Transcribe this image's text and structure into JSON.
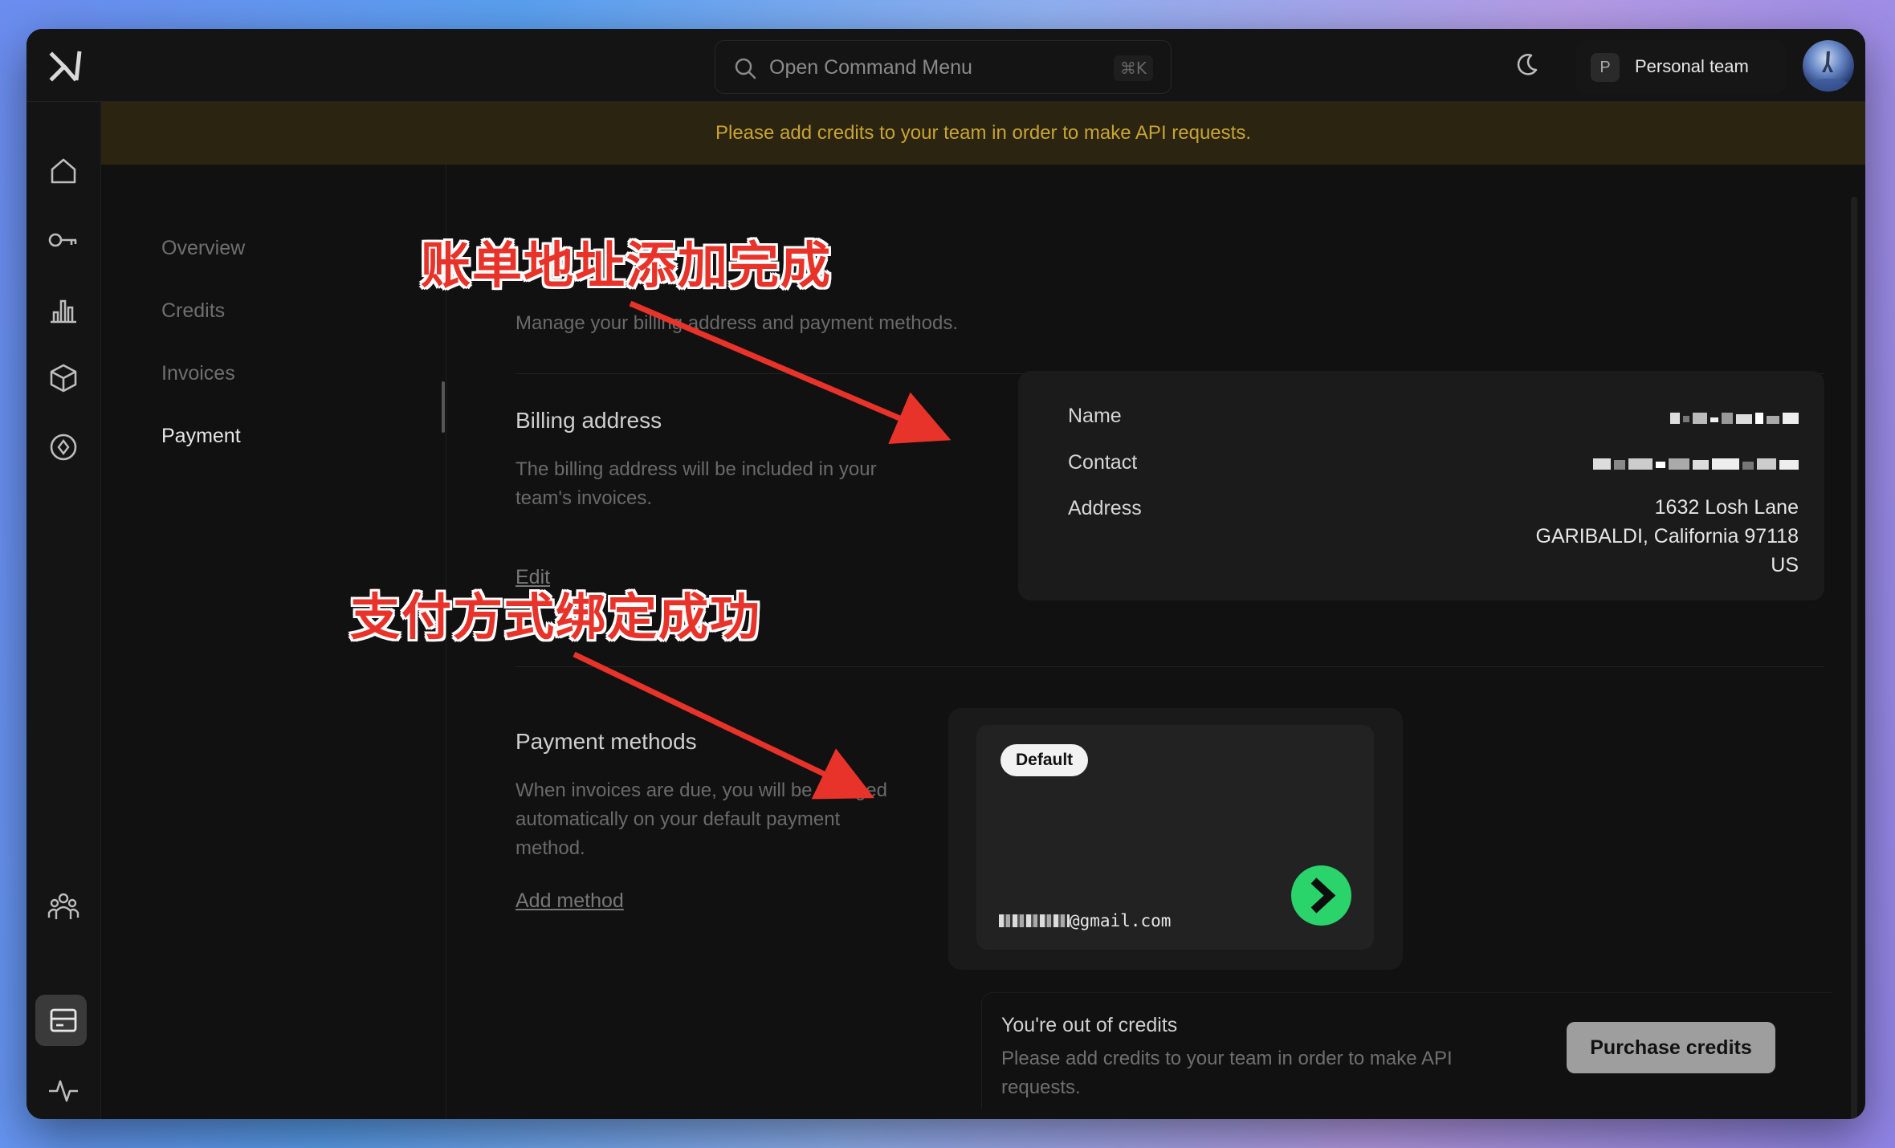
{
  "command_menu": {
    "placeholder": "Open Command Menu",
    "shortcut": "⌘K"
  },
  "team": {
    "initial": "P",
    "name": "Personal team"
  },
  "banner": {
    "text": "Please add credits to your team in order to make API requests."
  },
  "subnav": {
    "items": [
      {
        "label": "Overview"
      },
      {
        "label": "Credits"
      },
      {
        "label": "Invoices"
      },
      {
        "label": "Payment",
        "active": true
      }
    ]
  },
  "page": {
    "description": "Manage your billing address and payment methods."
  },
  "billing": {
    "title": "Billing address",
    "text": "The billing address will be included in your team's invoices.",
    "edit_label": "Edit",
    "name_label": "Name",
    "contact_label": "Contact",
    "address_label": "Address",
    "address_line1": "1632 Losh Lane",
    "address_line2": "GARIBALDI, California 97118",
    "address_line3": "US"
  },
  "payment": {
    "title": "Payment methods",
    "text": "When invoices are due, you will be charged automatically on your default payment method.",
    "add_label": "Add method",
    "default_badge": "Default",
    "email_suffix": "@gmail.com"
  },
  "credits": {
    "title": "You're out of credits",
    "text": "Please add credits to your team in order to make API requests.",
    "button": "Purchase credits"
  },
  "annotations": {
    "billing_done": "账单地址添加完成",
    "payment_done": "支付方式绑定成功"
  },
  "colors": {
    "banner_text": "#c9a434",
    "annotation": "#e8332a",
    "link_green": "#2bd36b"
  }
}
